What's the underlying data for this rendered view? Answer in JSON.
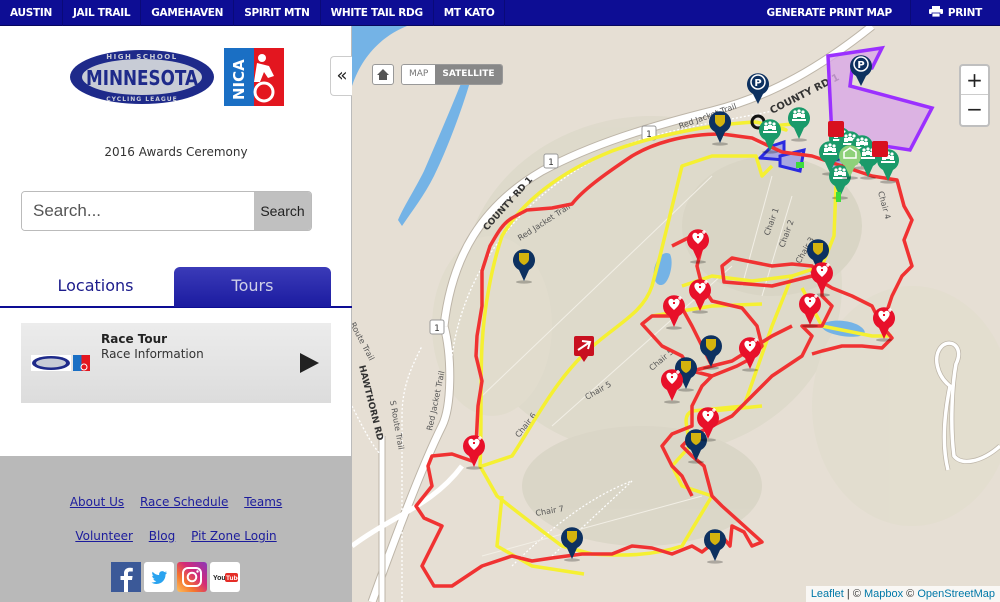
{
  "topnav": {
    "venues": [
      "AUSTIN",
      "JAIL TRAIL",
      "GAMEHAVEN",
      "SPIRIT MTN",
      "WHITE TAIL RDG",
      "MT KATO"
    ],
    "generate_print_map": "GENERATE PRINT MAP",
    "print": "PRINT"
  },
  "sidebar": {
    "logo_mn": {
      "top": "HIGH SCHOOL",
      "main": "MINNESOTA",
      "bottom": "CYCLING LEAGUE"
    },
    "logo_nica": "NICA",
    "subtitle": "2016 Awards Ceremony",
    "search": {
      "placeholder": "Search...",
      "value": "",
      "button": "Search"
    },
    "tabs": [
      {
        "label": "Locations",
        "active": false
      },
      {
        "label": "Tours",
        "active": true
      }
    ],
    "tour": {
      "title": "Race Tour",
      "subtitle": "Race Information"
    },
    "collapse_icon": "«",
    "footer": {
      "links_row1": [
        "About Us",
        "Race Schedule",
        "Teams"
      ],
      "links_row2": [
        "Volunteer",
        "Blog",
        "Pit Zone Login"
      ],
      "social": [
        "facebook",
        "twitter",
        "instagram",
        "youtube"
      ]
    }
  },
  "map": {
    "controls": {
      "home_icon": "home-icon",
      "map_type": [
        "MAP",
        "SATELLITE"
      ],
      "active_map_type": "SATELLITE",
      "zoom_in": "+",
      "zoom_out": "−"
    },
    "labels": {
      "county_rd_top": "COUNTY RD 1",
      "county_rd_left": "COUNTY RD 1",
      "red_jacket_1": "Red Jacket Trail",
      "red_jacket_2": "Red Jacket Trail",
      "red_jacket_3": "Red Jacket Trail",
      "route_shield": "1",
      "hawthorn": "HAWTHORN RD",
      "s_route": "S Route Trail",
      "route_trail": "Route Trail",
      "chairs": [
        "Chair 1",
        "Chair 2",
        "Chair 3",
        "Chair 4",
        "Chair 5",
        "Chair 6",
        "Chair 7",
        "Chair 4"
      ]
    },
    "colors": {
      "race_course": "#f03232",
      "alt_course": "#f5f032",
      "parking_zone": "#9b30ff",
      "team_zone": "#2a2ae0",
      "water": "#74b3e6",
      "medical_marker": "#e8102a",
      "police_marker": "#0d3160",
      "team_marker": "#1a9a6a",
      "land": "#e6dfd4"
    },
    "attribution": {
      "leaflet": "Leaflet",
      "sep": " | © ",
      "mapbox": "Mapbox",
      "osm_prefix": " © ",
      "osm": "OpenStreetMap"
    }
  }
}
